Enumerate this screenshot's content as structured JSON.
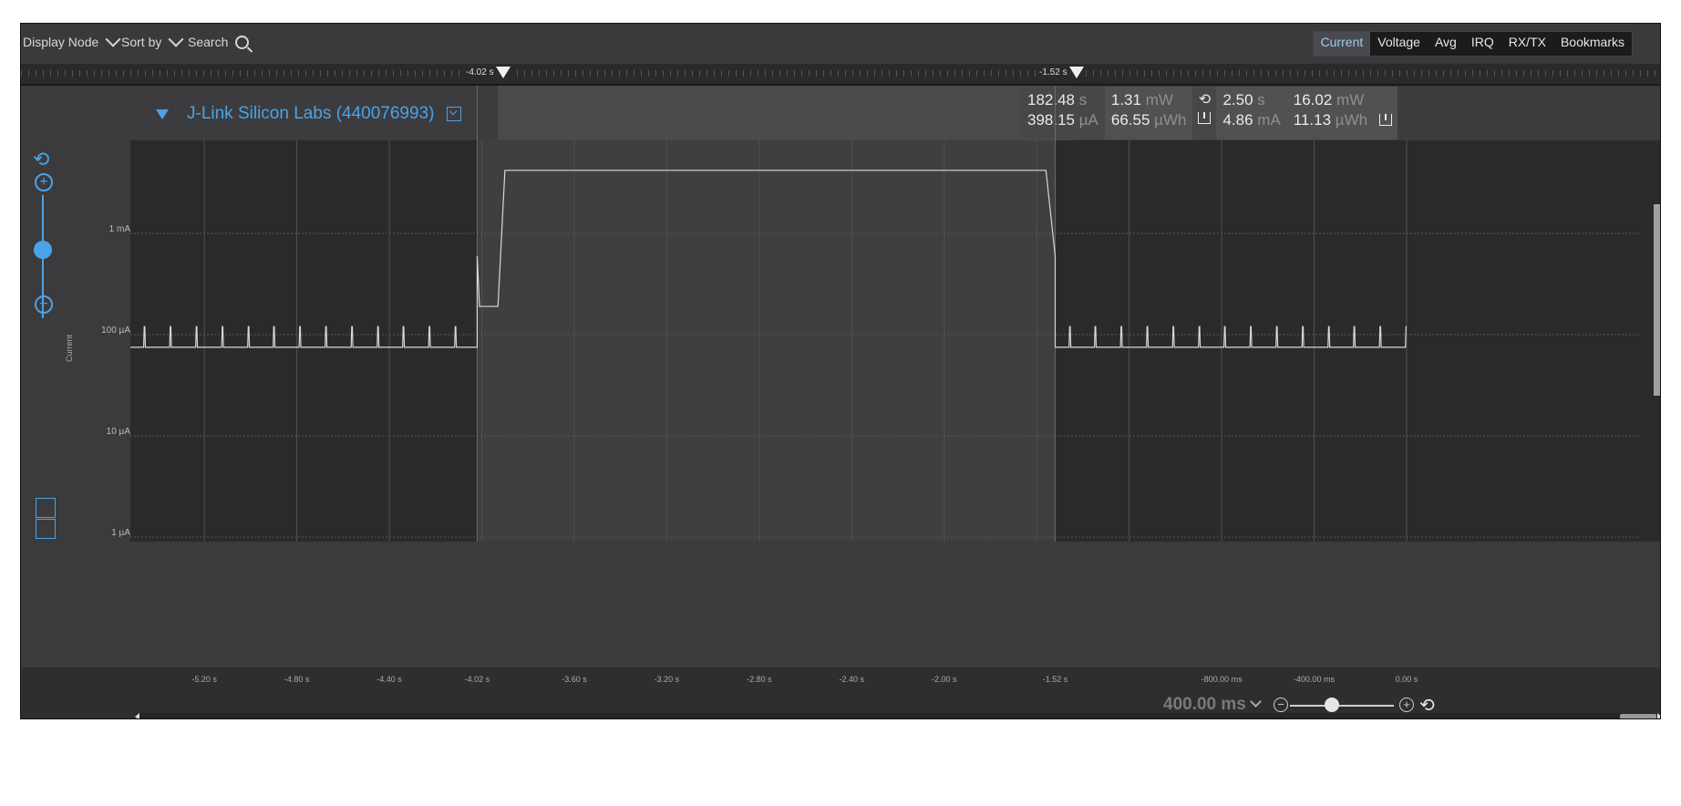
{
  "toolbar": {
    "display_node": "Display Node",
    "sort_by": "Sort by",
    "search": "Search",
    "tabs": [
      "Current",
      "Voltage",
      "Avg",
      "IRQ",
      "RX/TX",
      "Bookmarks"
    ],
    "active_tab": "Current"
  },
  "ruler": {
    "marker_left": "-4.02 s",
    "marker_right": "-1.52 s"
  },
  "device": {
    "name": "J-Link Silicon Labs (440076993)"
  },
  "stats": {
    "total_time": "182.48",
    "total_time_unit": "s",
    "total_current": "398.15",
    "total_current_unit": "µA",
    "total_power": "1.31",
    "total_power_unit": "mW",
    "total_energy": "66.55",
    "total_energy_unit": "µWh",
    "sel_time": "2.50",
    "sel_time_unit": "s",
    "sel_current": "4.86",
    "sel_current_unit": "mA",
    "sel_power": "16.02",
    "sel_power_unit": "mW",
    "sel_energy": "11.13",
    "sel_energy_unit": "µWh"
  },
  "y_axis": {
    "label": "Current",
    "ticks": [
      "1 mA",
      "100 µA",
      "10 µA",
      "1 µA"
    ]
  },
  "x_axis": {
    "ticks": [
      "-5.20 s",
      "-4.80 s",
      "-4.40 s",
      "-4.02 s",
      "-3.60 s",
      "-3.20 s",
      "-2.80 s",
      "-2.40 s",
      "-2.00 s",
      "-1.52 s",
      "-800.00 ms",
      "-400.00 ms",
      "0.00 s"
    ]
  },
  "zoom": {
    "readout": "400.00 ms"
  },
  "colors": {
    "accent": "#4aa3e8",
    "trace": "#d8d8d8",
    "plot_bg": "#2a2a2c",
    "selection_bg": "#3f3e40"
  },
  "chart_data": {
    "type": "line",
    "xlabel": "",
    "ylabel": "Current",
    "y_scale": "log",
    "ylim": [
      "1 µA",
      "10 mA"
    ],
    "xlim": [
      -5.52,
      0.0
    ],
    "selection": [
      -4.02,
      -1.52
    ],
    "series": [
      {
        "x": [
          -5.52,
          -4.02,
          -4.02,
          -4.01,
          -3.93,
          -3.9,
          -1.56,
          -1.52,
          -1.52,
          0.0
        ],
        "values_uA": [
          75,
          75,
          600,
          190,
          190,
          4200,
          4200,
          600,
          75,
          75
        ]
      }
    ],
    "notes_visible": "periodic spikes ~120 µA every ~0.11 s outside selection"
  }
}
